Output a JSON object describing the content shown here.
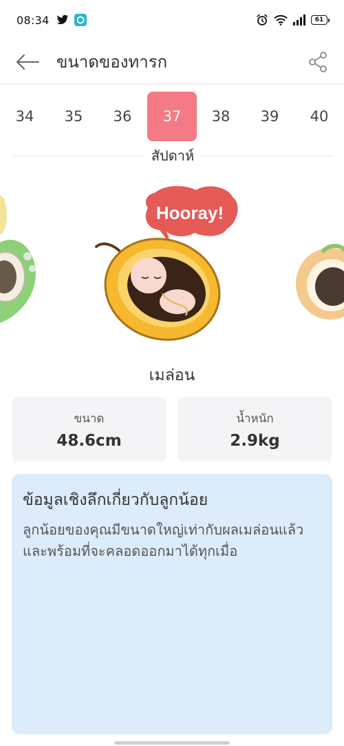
{
  "status_bar": {
    "time": "08:34",
    "battery": "61",
    "icons": [
      "twitter-icon",
      "messaging-app-icon",
      "alarm-icon",
      "wifi-icon",
      "signal-icon",
      "battery-icon"
    ]
  },
  "header": {
    "title": "ขนาดของทารก",
    "back_icon": "arrow-left-icon",
    "share_icon": "share-icon"
  },
  "weeks": {
    "items": [
      "34",
      "35",
      "36",
      "37",
      "38",
      "39",
      "40"
    ],
    "selected": "37",
    "label": "สัปดาห์"
  },
  "illustration": {
    "bubble_text": "Hooray!",
    "accent_colors": {
      "melon": "#f5b82e",
      "bubble": "#e55a55",
      "leaf": "#7cc56b"
    }
  },
  "fruit": {
    "name": "เมล่อน"
  },
  "stats": {
    "size_label": "ขนาด",
    "size_value": "48.6cm",
    "weight_label": "น้ำหนัก",
    "weight_value": "2.9kg"
  },
  "insight": {
    "title": "ข้อมูลเชิงลึกเกี่ยวกับลูกน้อย",
    "body": "ลูกน้อยของคุณมีขนาดใหญ่เท่ากับผลเมล่อนแล้ว และพร้อมที่จะคลอดออกมาได้ทุกเมื่อ"
  },
  "colors": {
    "accent": "#f47b85",
    "card_bg": "#f4f4f6",
    "insight_bg": "#ddecfb"
  }
}
